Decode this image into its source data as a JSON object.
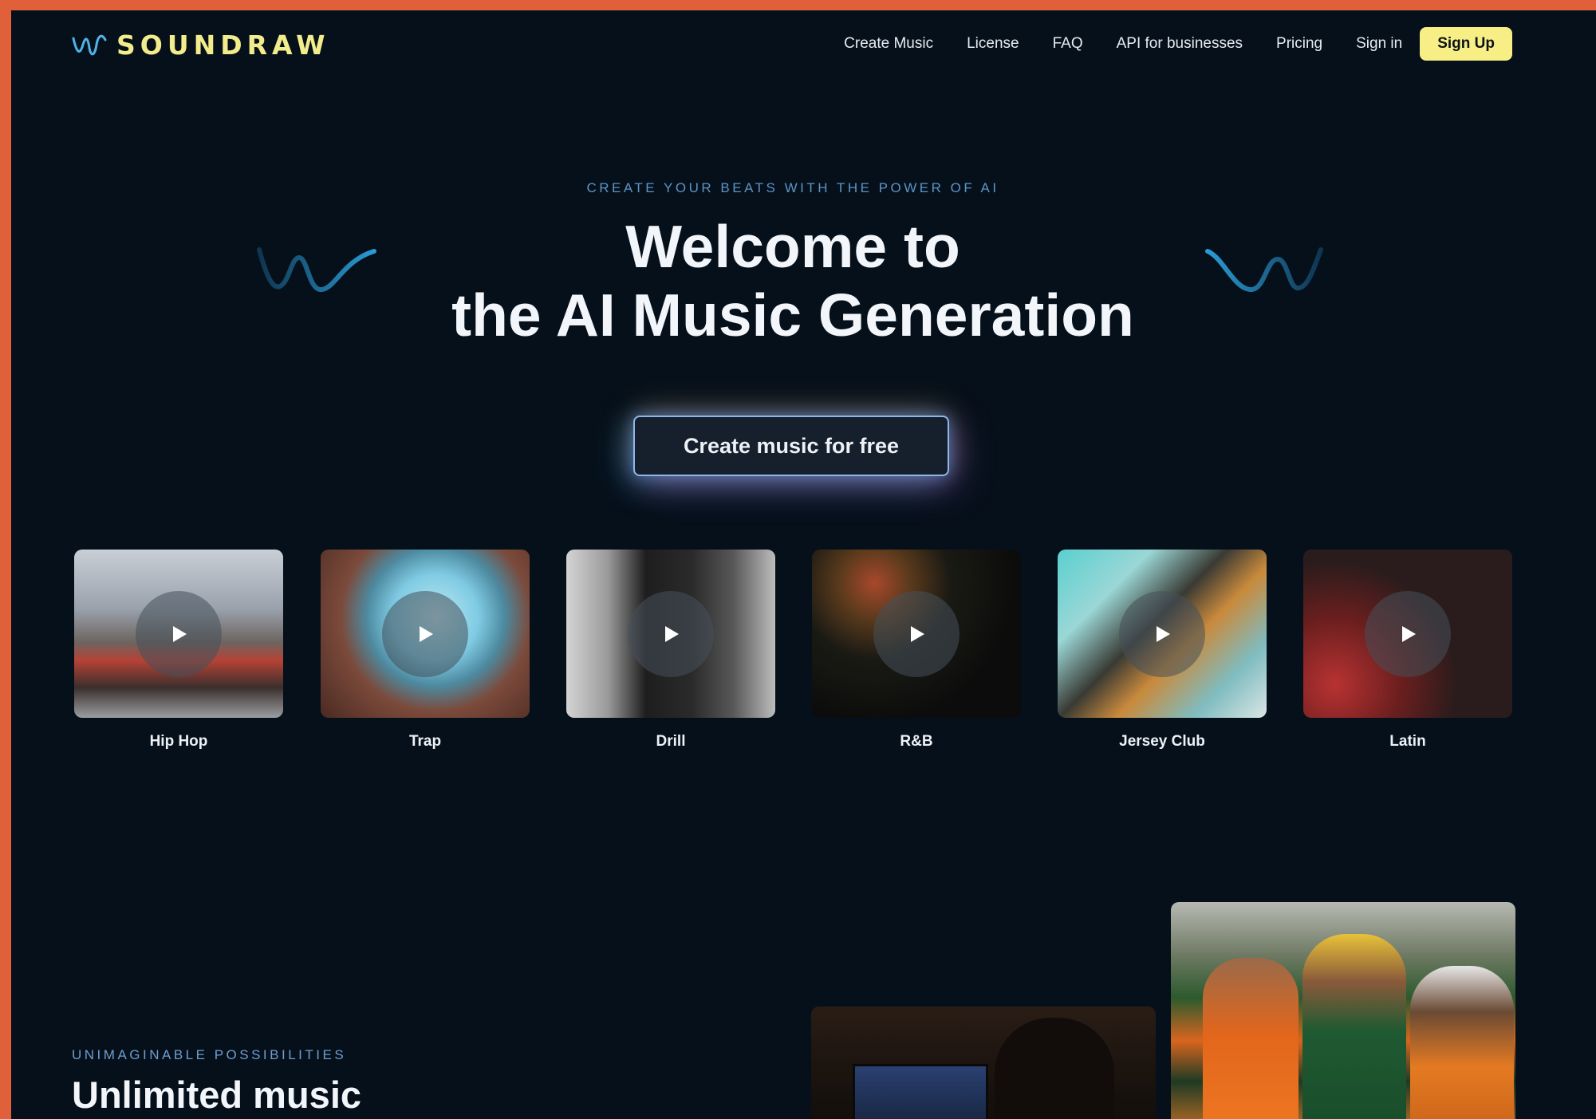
{
  "brand": {
    "name": "SOUNDRAW",
    "accent": "#f7ef86",
    "background": "#06101a"
  },
  "nav": {
    "links": [
      "Create Music",
      "License",
      "FAQ",
      "API for businesses",
      "Pricing",
      "Sign in"
    ],
    "signup_label": "Sign Up"
  },
  "hero": {
    "eyebrow": "CREATE YOUR BEATS WITH THE POWER OF AI",
    "title_line1": "Welcome to",
    "title_line2": "the AI Music Generation",
    "cta_label": "Create music for free"
  },
  "genres": [
    {
      "label": "Hip Hop",
      "icon": "play-icon"
    },
    {
      "label": "Trap",
      "icon": "play-icon"
    },
    {
      "label": "Drill",
      "icon": "play-icon"
    },
    {
      "label": "R&B",
      "icon": "play-icon"
    },
    {
      "label": "Jersey Club",
      "icon": "play-icon"
    },
    {
      "label": "Latin",
      "icon": "play-icon"
    }
  ],
  "section2": {
    "eyebrow": "UNIMAGINABLE POSSIBILITIES",
    "title": "Unlimited music"
  }
}
